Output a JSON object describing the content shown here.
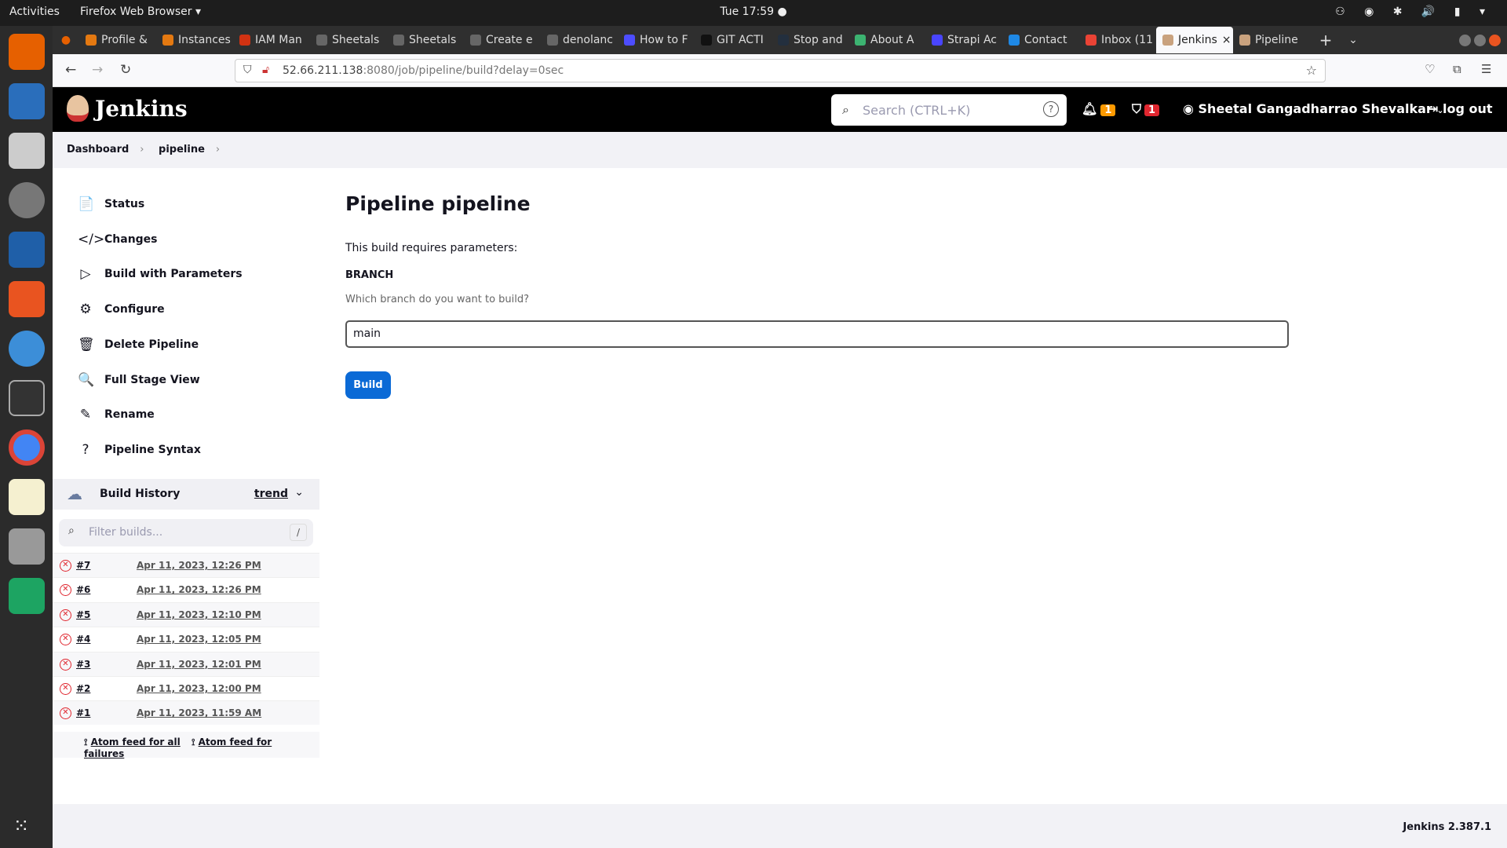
{
  "system": {
    "activities": "Activities",
    "app": "Firefox Web Browser ▾",
    "clock": "Tue 17:59 ●"
  },
  "browser": {
    "tabs": [
      {
        "label": "Profile &",
        "color": "#e47911"
      },
      {
        "label": "Instances",
        "color": "#e47911"
      },
      {
        "label": "IAM Man",
        "color": "#d13212"
      },
      {
        "label": "Sheetals",
        "color": "#666"
      },
      {
        "label": "Sheetals",
        "color": "#666"
      },
      {
        "label": "Create e",
        "color": "#666"
      },
      {
        "label": "denolanc",
        "color": "#666"
      },
      {
        "label": "How to F",
        "color": "#4d4dff"
      },
      {
        "label": "GIT ACTI",
        "color": "#111"
      },
      {
        "label": "Stop and",
        "color": "#232f3e"
      },
      {
        "label": "About A",
        "color": "#3cb371"
      },
      {
        "label": "Strapi Ac",
        "color": "#4945ff"
      },
      {
        "label": "Contact",
        "color": "#1e88e5"
      },
      {
        "label": "Inbox (11",
        "color": "#ea4335"
      },
      {
        "label": "Jenkins",
        "color": "#c9a27e",
        "active": true
      },
      {
        "label": "Pipeline",
        "color": "#c9a27e"
      }
    ],
    "url_host": "52.66.211.138",
    "url_rest": ":8080/job/pipeline/build?delay=0sec"
  },
  "header": {
    "title": "Jenkins",
    "search_placeholder": "Search (CTRL+K)",
    "notifications": "1",
    "security": "1",
    "user": "Sheetal Gangadharrao Shevalkar",
    "logout": "log out"
  },
  "breadcrumb": [
    "Dashboard",
    "pipeline"
  ],
  "sidebar": {
    "items": [
      {
        "label": "Status",
        "icon": "📄"
      },
      {
        "label": "Changes",
        "icon": "</>"
      },
      {
        "label": "Build with Parameters",
        "icon": "▷"
      },
      {
        "label": "Configure",
        "icon": "⚙"
      },
      {
        "label": "Delete Pipeline",
        "icon": "🗑"
      },
      {
        "label": "Full Stage View",
        "icon": "🔍"
      },
      {
        "label": "Rename",
        "icon": "✎"
      },
      {
        "label": "Pipeline Syntax",
        "icon": "?"
      }
    ]
  },
  "history": {
    "title": "Build History",
    "trend": "trend",
    "filter_placeholder": "Filter builds...",
    "shortcut": "/",
    "builds": [
      {
        "n": "#7",
        "d": "Apr 11, 2023, 12:26 PM"
      },
      {
        "n": "#6",
        "d": "Apr 11, 2023, 12:26 PM"
      },
      {
        "n": "#5",
        "d": "Apr 11, 2023, 12:10 PM"
      },
      {
        "n": "#4",
        "d": "Apr 11, 2023, 12:05 PM"
      },
      {
        "n": "#3",
        "d": "Apr 11, 2023, 12:01 PM"
      },
      {
        "n": "#2",
        "d": "Apr 11, 2023, 12:00 PM"
      },
      {
        "n": "#1",
        "d": "Apr 11, 2023, 11:59 AM"
      }
    ],
    "feed_all": "Atom feed for all",
    "feed_fail": "Atom feed for failures"
  },
  "main": {
    "title": "Pipeline pipeline",
    "intro": "This build requires parameters:",
    "param_name": "BRANCH",
    "param_desc": "Which branch do you want to build?",
    "param_value": "main",
    "build": "Build"
  },
  "footer": {
    "version": "Jenkins 2.387.1"
  }
}
